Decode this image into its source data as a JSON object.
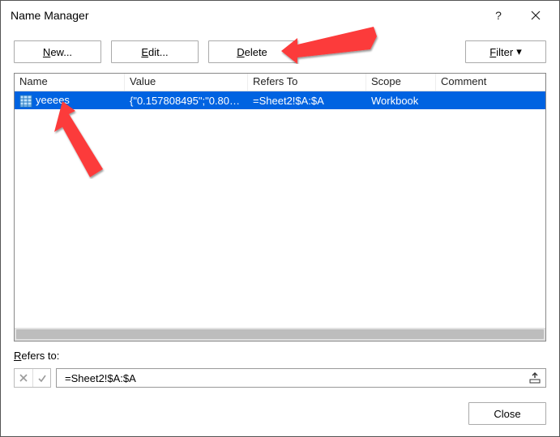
{
  "title": "Name Manager",
  "toolbar": {
    "new_prefix": "",
    "new_u": "N",
    "new_suffix": "ew...",
    "edit_prefix": "",
    "edit_u": "E",
    "edit_suffix": "dit...",
    "delete_prefix": "",
    "delete_u": "D",
    "delete_suffix": "elete",
    "filter_prefix": "",
    "filter_u": "F",
    "filter_suffix": "ilter"
  },
  "columns": {
    "name": "Name",
    "value": "Value",
    "refers": "Refers To",
    "scope": "Scope",
    "comment": "Comment"
  },
  "rows": [
    {
      "name": "yeeees",
      "value": "{\"0.157808495\";\"0.804...",
      "refers": "=Sheet2!$A:$A",
      "scope": "Workbook",
      "comment": ""
    }
  ],
  "refersto": {
    "label_prefix": "",
    "label_u": "R",
    "label_suffix": "efers to:",
    "value": "=Sheet2!$A:$A"
  },
  "footer": {
    "close": "Close"
  },
  "icons": {
    "help": "?",
    "close_x": "✕",
    "cancel_x": "✕",
    "accept_check": "✓",
    "caret": "▾",
    "collapse_up": "⬆"
  }
}
